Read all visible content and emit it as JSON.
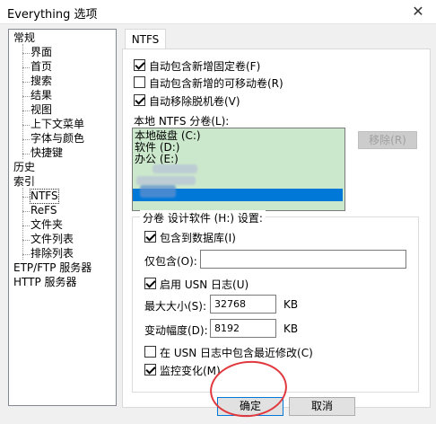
{
  "window": {
    "title": "Everything 选项",
    "close_glyph": "✕"
  },
  "tree": {
    "items": [
      {
        "label": "常规",
        "level": 0
      },
      {
        "label": "界面",
        "level": 1
      },
      {
        "label": "首页",
        "level": 1
      },
      {
        "label": "搜索",
        "level": 1
      },
      {
        "label": "结果",
        "level": 1
      },
      {
        "label": "视图",
        "level": 1
      },
      {
        "label": "上下文菜单",
        "level": 1
      },
      {
        "label": "字体与颜色",
        "level": 1
      },
      {
        "label": "快捷键",
        "level": 1
      },
      {
        "label": "历史",
        "level": 0
      },
      {
        "label": "索引",
        "level": 0
      },
      {
        "label": "NTFS",
        "level": 1,
        "selected": true
      },
      {
        "label": "ReFS",
        "level": 1
      },
      {
        "label": "文件夹",
        "level": 1
      },
      {
        "label": "文件列表",
        "level": 1
      },
      {
        "label": "排除列表",
        "level": 1
      },
      {
        "label": "ETP/FTP 服务器",
        "level": 0
      },
      {
        "label": "HTTP 服务器",
        "level": 0
      }
    ]
  },
  "tab": {
    "label": "NTFS"
  },
  "options": {
    "auto_include_fixed": {
      "label": "自动包含新增固定卷(F)",
      "checked": true
    },
    "auto_include_removable": {
      "label": "自动包含新增的可移动卷(R)",
      "checked": false
    },
    "auto_remove_offline": {
      "label": "自动移除脱机卷(V)",
      "checked": true
    }
  },
  "volumes": {
    "label": "本地 NTFS 分卷(L):",
    "rows": [
      "本地磁盘 (C:)",
      "软件 (D:)",
      "办公 (E:)"
    ],
    "remove_button": "移除(R)"
  },
  "group": {
    "title": "分卷 设计软件 (H:) 设置:",
    "include_in_db": {
      "label": "包含到数据库(I)",
      "checked": true
    },
    "include_only_label": "仅包含(O):",
    "include_only_value": "",
    "enable_usn": {
      "label": "启用 USN 日志(U)",
      "checked": true
    },
    "max_size_label": "最大大小(S):",
    "max_size_value": "32768",
    "max_size_unit": "KB",
    "allocation_label": "变动幅度(D):",
    "allocation_value": "8192",
    "allocation_unit": "KB",
    "include_recent": {
      "label": "在 USN 日志中包含最近修改(C)",
      "checked": false
    },
    "monitor_changes": {
      "label": "监控变化(M)",
      "checked": true
    }
  },
  "footer": {
    "ok": "确定",
    "cancel": "取消"
  },
  "colors": {
    "accent": "#0078d7",
    "listbox_bg": "#cce8cc",
    "annotation": "#e0393e"
  }
}
